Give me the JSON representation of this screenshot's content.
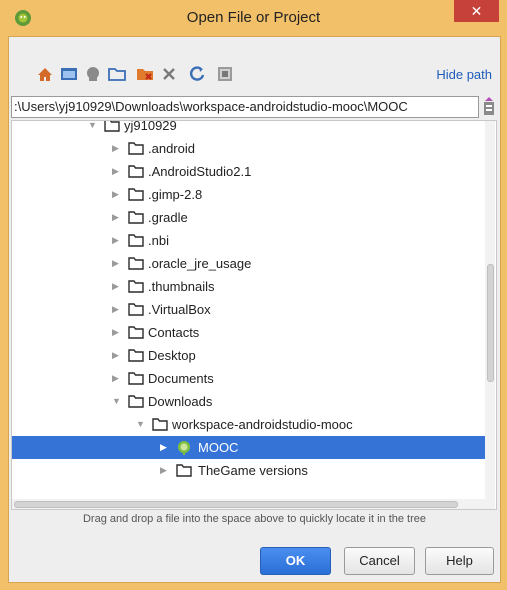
{
  "window": {
    "title": "Open File or Project",
    "close_label": "✕"
  },
  "toolbar": {
    "icons": [
      "home-icon",
      "desktop-icon",
      "android-icon",
      "new-folder-icon",
      "delete-folder-icon",
      "delete-icon",
      "refresh-icon",
      "show-hidden-icon"
    ],
    "hide_path_label": "Hide path"
  },
  "path": {
    "value": ":\\Users\\yj910929\\Downloads\\workspace-androidstudio-mooc\\MOOC"
  },
  "tree": {
    "root": {
      "label": "yj910929",
      "expanded": true
    },
    "children": [
      {
        "label": ".android"
      },
      {
        "label": ".AndroidStudio2.1"
      },
      {
        "label": ".gimp-2.8"
      },
      {
        "label": ".gradle"
      },
      {
        "label": ".nbi"
      },
      {
        "label": ".oracle_jre_usage"
      },
      {
        "label": ".thumbnails"
      },
      {
        "label": ".VirtualBox"
      },
      {
        "label": "Contacts"
      },
      {
        "label": "Desktop"
      },
      {
        "label": "Documents"
      },
      {
        "label": "Downloads",
        "expanded": true
      }
    ],
    "workspace": {
      "label": "workspace-androidstudio-mooc",
      "expanded": true
    },
    "mooc": {
      "label": "MOOC",
      "selected": true
    },
    "thegame": {
      "label": "TheGame versions"
    }
  },
  "hint": "Drag and drop a file into the space above to quickly locate it in the tree",
  "buttons": {
    "ok": "OK",
    "cancel": "Cancel",
    "help": "Help"
  },
  "colors": {
    "selection": "#3574d6",
    "folder": "#2b2b2b",
    "accent": "#1d5cba",
    "frame": "#f3c06a"
  }
}
